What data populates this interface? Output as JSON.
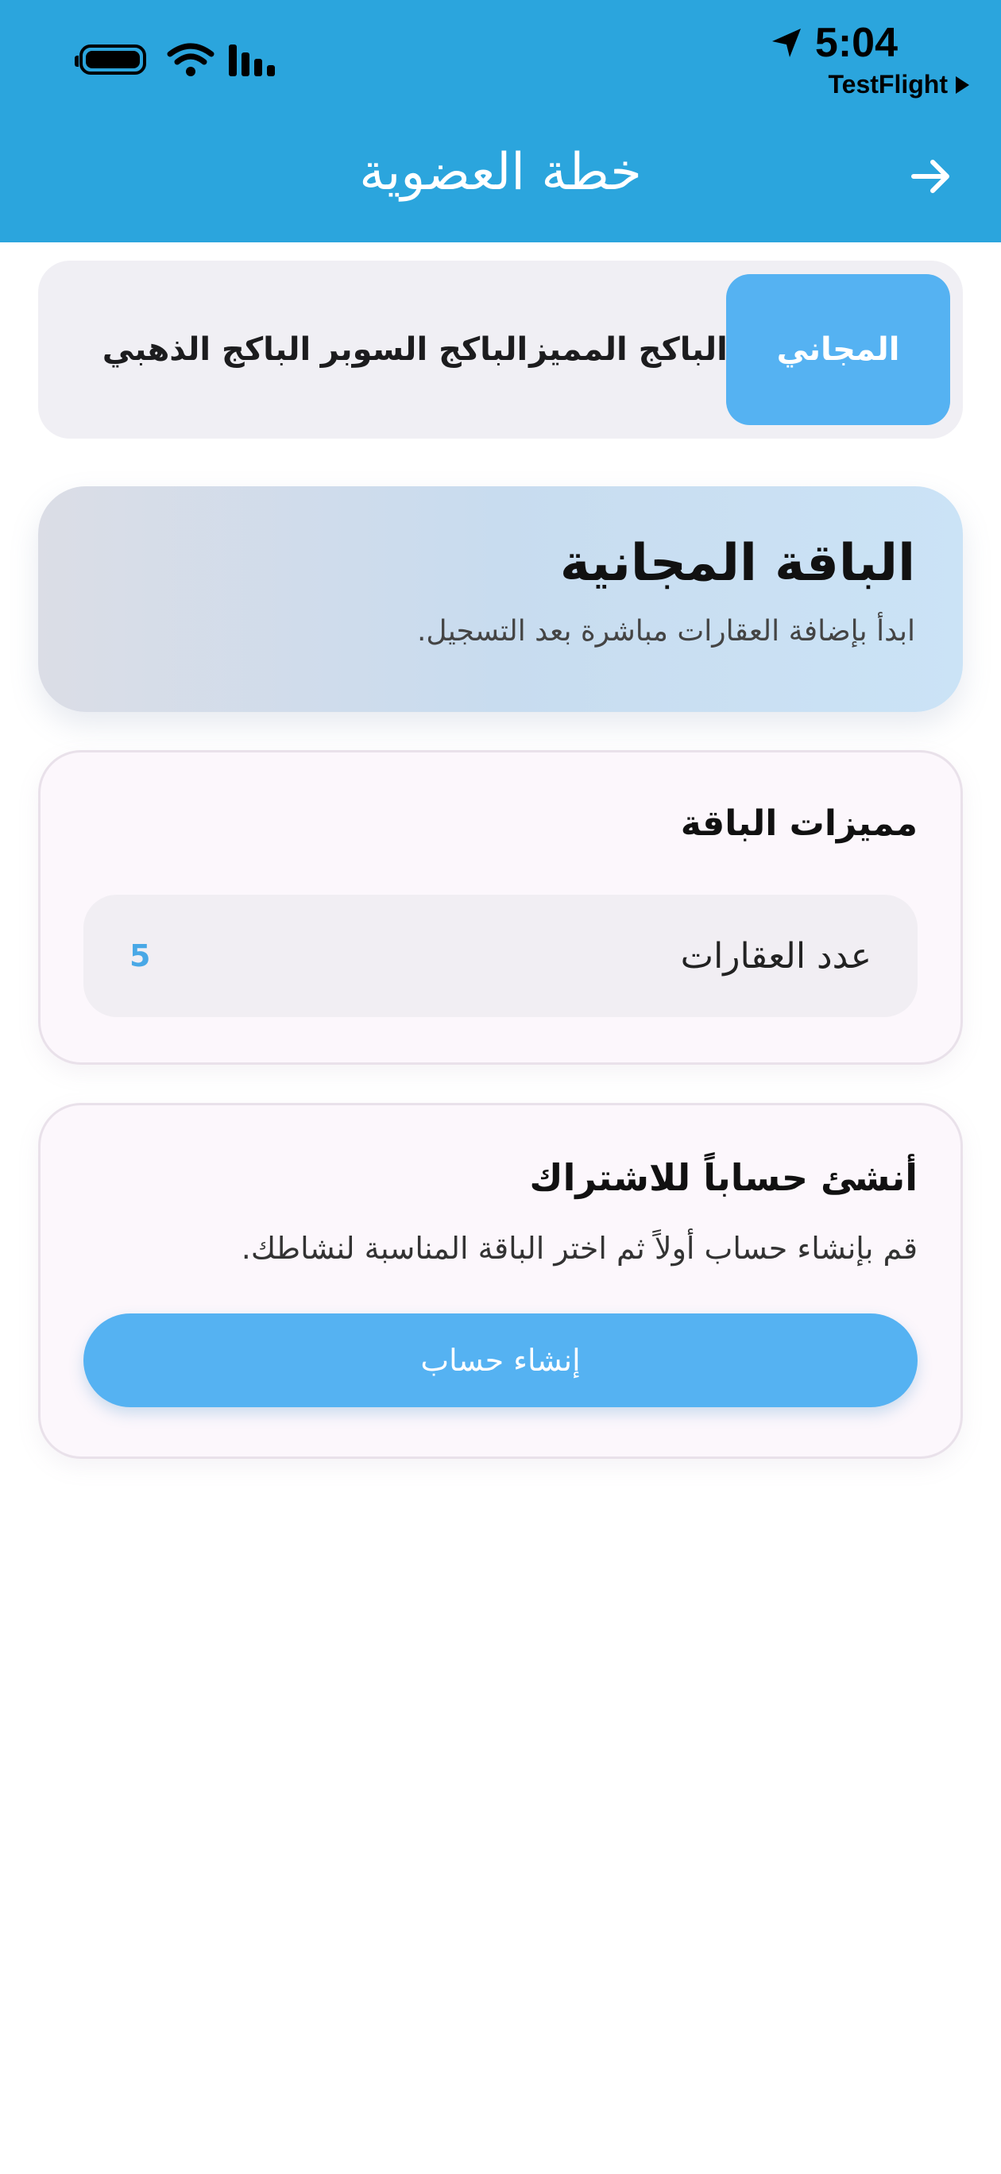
{
  "status_bar": {
    "time": "5:04",
    "back_app": "TestFlight"
  },
  "header": {
    "title": "خطة العضوية",
    "back_icon": "arrow-right-icon"
  },
  "tabs": [
    {
      "label": "المجاني",
      "active": true
    },
    {
      "label": "الباكج المميز",
      "active": false
    },
    {
      "label": "الباكج السوبر",
      "active": false
    },
    {
      "label": "الباكج الذهبي",
      "active": false
    }
  ],
  "plan": {
    "title": "الباقة المجانية",
    "description": "ابدأ بإضافة العقارات مباشرة بعد التسجيل."
  },
  "features": {
    "title": "مميزات الباقة",
    "items": [
      {
        "label": "عدد العقارات",
        "value": "5"
      }
    ]
  },
  "signup": {
    "title": "أنشئ حساباً للاشتراك",
    "description": "قم بإنشاء حساب أولاً ثم اختر الباقة المناسبة لنشاطك.",
    "button_label": "إنشاء حساب"
  },
  "colors": {
    "header": "#2ba5dd",
    "accent": "#55b2f2",
    "value": "#49a8e6"
  }
}
